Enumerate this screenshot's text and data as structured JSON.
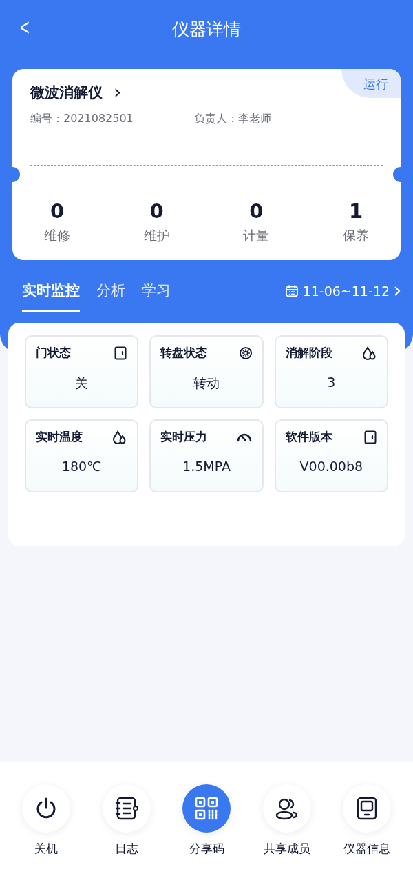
{
  "nav": {
    "back": "<",
    "title": "仪器详情"
  },
  "device": {
    "name": "微波消解仪",
    "arrow": "›",
    "status": "运行",
    "id_label": "编号：",
    "id": "2021082501",
    "owner_label": "负责人：",
    "owner": "李老师",
    "stats": [
      {
        "value": "0",
        "label": "维修"
      },
      {
        "value": "0",
        "label": "维护"
      },
      {
        "value": "0",
        "label": "计量"
      },
      {
        "value": "1",
        "label": "保养"
      }
    ]
  },
  "tabs": [
    {
      "label": "实时监控",
      "selected": true
    },
    {
      "label": "分析",
      "selected": false
    },
    {
      "label": "学习",
      "selected": false
    }
  ],
  "date_range": "11-06~11-12",
  "monitors": [
    {
      "title": "门状态",
      "value": "关",
      "kind": "door"
    },
    {
      "title": "转盘状态",
      "value": "转动",
      "kind": "turntable"
    },
    {
      "title": "消解阶段",
      "value": "3",
      "kind": "drops"
    },
    {
      "title": "实时温度",
      "value": "180℃",
      "kind": "drops"
    },
    {
      "title": "实时压力",
      "value": "1.5MPA",
      "kind": "gauge"
    },
    {
      "title": "软件版本",
      "value": "V00.00b8",
      "kind": "door"
    }
  ],
  "actions": [
    {
      "label": "关机",
      "kind": "power",
      "selected": false
    },
    {
      "label": "日志",
      "kind": "log",
      "selected": false
    },
    {
      "label": "分享码",
      "kind": "qr",
      "selected": true
    },
    {
      "label": "共享成员",
      "kind": "members",
      "selected": false
    },
    {
      "label": "仪器信息",
      "kind": "device",
      "selected": false
    }
  ]
}
